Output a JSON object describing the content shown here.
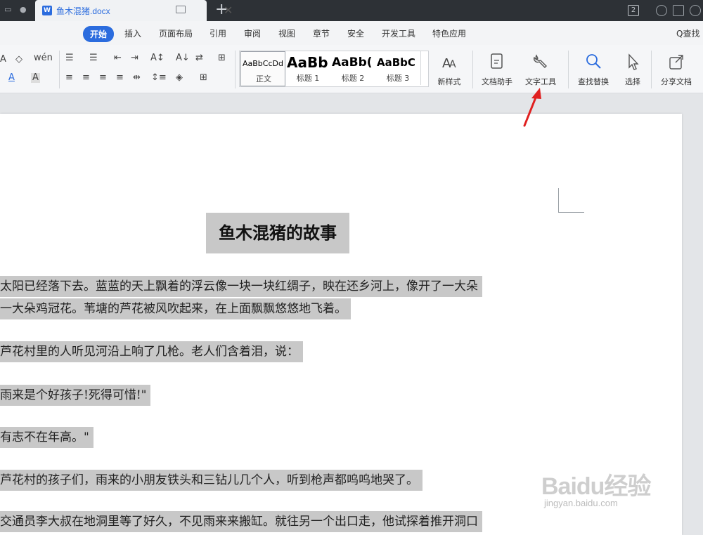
{
  "window": {
    "doc_tab_name": "鱼木混猪.docx",
    "badge_count": "2",
    "new_tab_symbol": "+"
  },
  "menu": {
    "items": [
      "开始",
      "插入",
      "页面布局",
      "引用",
      "审阅",
      "视图",
      "章节",
      "安全",
      "开发工具",
      "特色应用"
    ],
    "active": "开始",
    "search_label": "Q查找"
  },
  "toolbar": {
    "styles": [
      {
        "sample": "AaBbCcDd",
        "label": "正文"
      },
      {
        "sample": "AaBb",
        "label": "标题 1"
      },
      {
        "sample": "AaBb(",
        "label": "标题 2"
      },
      {
        "sample": "AaBbC",
        "label": "标题 3"
      }
    ],
    "new_style_label": "新样式",
    "doc_helper_label": "文档助手",
    "text_tools_label": "文字工具",
    "find_replace_label": "查找替换",
    "select_label": "选择",
    "share_doc_label": "分享文档"
  },
  "document": {
    "title": "鱼木混猪的故事",
    "lines": [
      "太阳已经落下去。蓝蓝的天上飘着的浮云像一块一块红绸子，映在还乡河上，像开了一大朵",
      "一大朵鸡冠花。苇塘的芦花被风吹起来，在上面飘飘悠悠地飞着。",
      "芦花村里的人听见河沿上响了几枪。老人们含着泪，说：",
      "雨来是个好孩子!死得可惜!\"",
      "有志不在年高。\"",
      "芦花村的孩子们，雨来的小朋友铁头和三钻儿几个人，听到枪声都呜呜地哭了。",
      "交通员李大叔在地洞里等了好久，不见雨来来搬缸。就往另一个出口走，他试探着推开洞口"
    ]
  },
  "watermark": {
    "main": "Baidu经验",
    "sub": "jingyan.baidu.com"
  },
  "colors": {
    "accent": "#2b6cde",
    "highlight": "#c8c8c8",
    "annotation": "#e02020"
  }
}
